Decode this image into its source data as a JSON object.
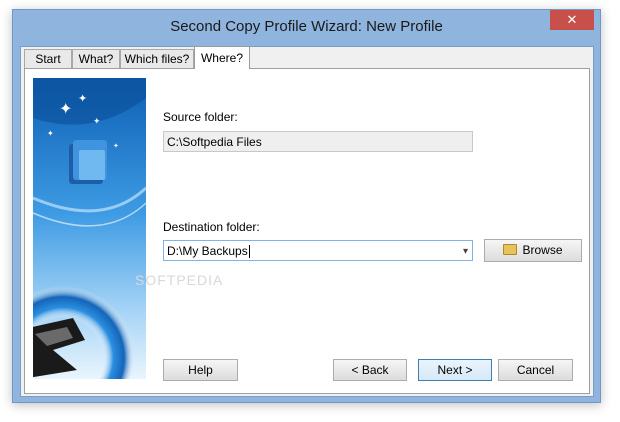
{
  "window": {
    "title": "Second Copy Profile Wizard: New Profile",
    "close_glyph": "✕"
  },
  "tabs": [
    {
      "label": "Start"
    },
    {
      "label": "What?"
    },
    {
      "label": "Which files?"
    },
    {
      "label": "Where?",
      "active": true
    }
  ],
  "source": {
    "label": "Source folder:",
    "value": "C:\\Softpedia Files"
  },
  "destination": {
    "label": "Destination folder:",
    "value": "D:\\My Backups",
    "dropdown_glyph": "▾"
  },
  "browse_button": {
    "label": "Browse",
    "icon": "open-folder-icon"
  },
  "buttons": {
    "help": "Help",
    "back": "< Back",
    "next": "Next >",
    "cancel": "Cancel"
  },
  "watermark": "SOFTPEDIA",
  "colors": {
    "title_bar": "#8fb4de",
    "close_button": "#c7514a",
    "accent_blue": "#1f7fd0"
  }
}
